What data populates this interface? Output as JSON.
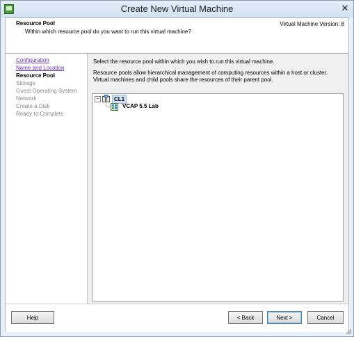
{
  "window": {
    "title": "Create New Virtual Machine",
    "close_glyph": "✕"
  },
  "header": {
    "title": "Resource Pool",
    "subtitle": "Within which resource pool do you want to run this virtual machine?",
    "version": "Virtual Machine Version: 8"
  },
  "steps": [
    {
      "label": "Configuration",
      "state": "completed"
    },
    {
      "label": "Name and Location",
      "state": "completed"
    },
    {
      "label": "Resource Pool",
      "state": "current"
    },
    {
      "label": "Storage",
      "state": "pending"
    },
    {
      "label": "Guest Operating System",
      "state": "pending"
    },
    {
      "label": "Network",
      "state": "pending"
    },
    {
      "label": "Create a Disk",
      "state": "pending"
    },
    {
      "label": "Ready to Complete",
      "state": "pending"
    }
  ],
  "main": {
    "instruction": "Select the resource pool within which you wish to run this virtual machine.",
    "description": "Resource pools allow hierarchical management of computing resources within a host or cluster. Virtual machines and child pools share the resources of their parent pool."
  },
  "tree": {
    "expander_glyph": "⊟",
    "cluster": {
      "label": "CL1",
      "icon": "cluster-icon",
      "selected": true
    },
    "children": [
      {
        "label": "VCAP 5.5 Lab",
        "icon": "resource-pool-icon"
      }
    ]
  },
  "buttons": {
    "help": "Help",
    "back": "< Back",
    "next": "Next >",
    "cancel": "Cancel"
  },
  "colors": {
    "link": "#6a30c8",
    "selection": "#cfe0f4"
  }
}
